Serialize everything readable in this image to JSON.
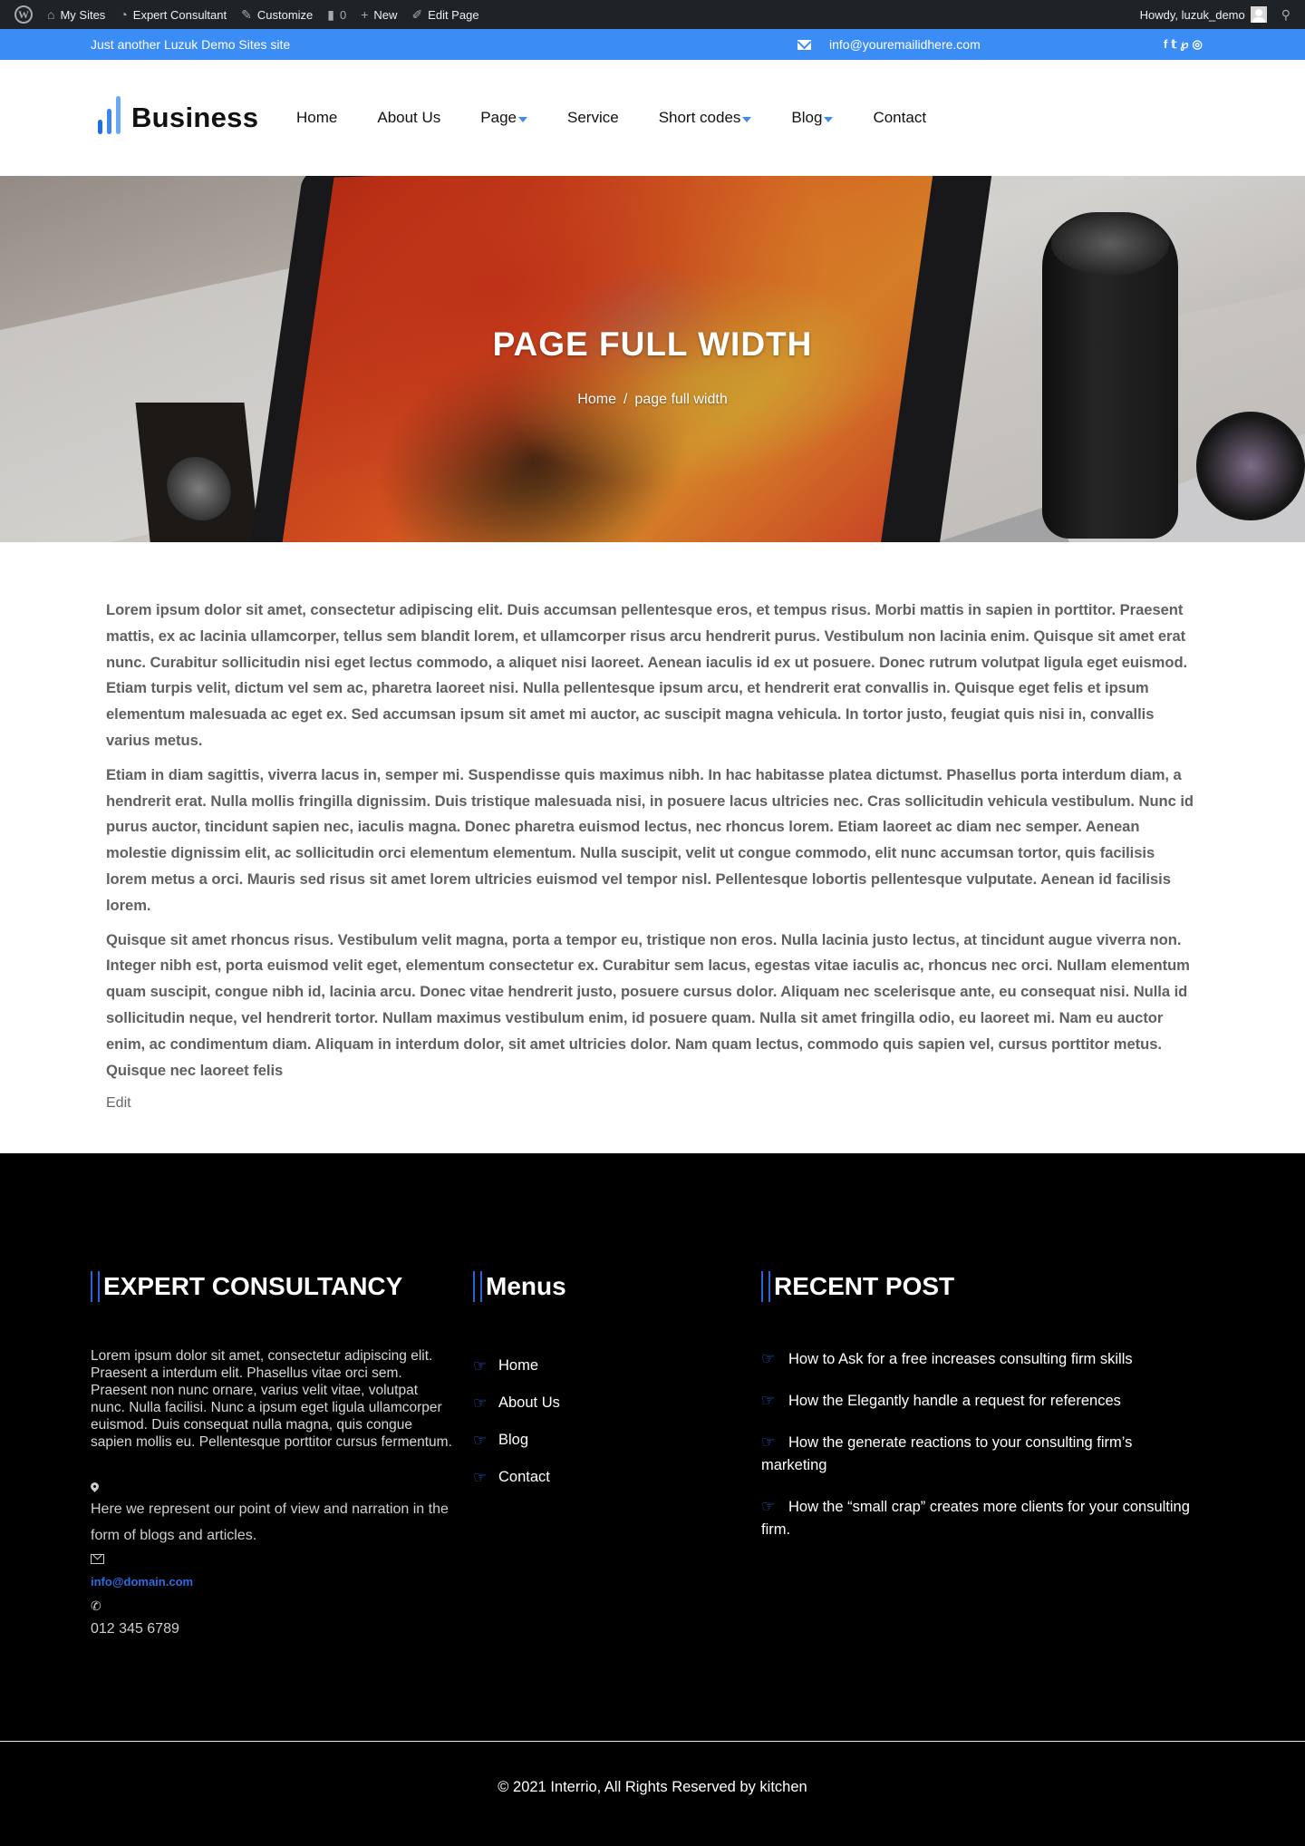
{
  "admin_bar": {
    "items": [
      {
        "label": "My Sites",
        "icon": "my-sites-icon"
      },
      {
        "label": "Expert Consultant",
        "icon": "dashboard-icon"
      },
      {
        "label": "Customize",
        "icon": "brush-icon"
      },
      {
        "label": "0",
        "icon": "comment-icon"
      },
      {
        "label": "New",
        "icon": "plus-icon"
      },
      {
        "label": "Edit Page",
        "icon": "pencil-icon"
      }
    ],
    "greeting": "Howdy, luzuk_demo"
  },
  "topbar": {
    "tagline": "Just another Luzuk Demo Sites site",
    "email": "info@youremailidhere.com",
    "social": [
      "f",
      "t",
      "p",
      "i"
    ]
  },
  "header": {
    "logo_text": "Business",
    "nav": [
      {
        "label": "Home",
        "has_dropdown": false
      },
      {
        "label": "About Us",
        "has_dropdown": false
      },
      {
        "label": "Page",
        "has_dropdown": true
      },
      {
        "label": "Service",
        "has_dropdown": false
      },
      {
        "label": "Short codes",
        "has_dropdown": true
      },
      {
        "label": "Blog",
        "has_dropdown": true
      },
      {
        "label": "Contact",
        "has_dropdown": false
      }
    ]
  },
  "hero": {
    "title": "PAGE FULL WIDTH",
    "breadcrumb": {
      "home": "Home",
      "separator": "/",
      "current": "page full width"
    }
  },
  "content": {
    "paragraphs": [
      "Lorem ipsum dolor sit amet, consectetur adipiscing elit. Duis accumsan pellentesque eros, et tempus risus. Morbi mattis in sapien in porttitor. Praesent mattis, ex ac lacinia ullamcorper, tellus sem blandit lorem, et ullamcorper risus arcu hendrerit purus. Vestibulum non lacinia enim. Quisque sit amet erat nunc. Curabitur sollicitudin nisi eget lectus commodo, a aliquet nisi laoreet. Aenean iaculis id ex ut posuere. Donec rutrum volutpat ligula eget euismod. Etiam turpis velit, dictum vel sem ac, pharetra laoreet nisi. Nulla pellentesque ipsum arcu, et hendrerit erat convallis in. Quisque eget felis et ipsum elementum malesuada ac eget ex. Sed accumsan ipsum sit amet mi auctor, ac suscipit magna vehicula. In tortor justo, feugiat quis nisi in, convallis varius metus.",
      "Etiam in diam sagittis, viverra lacus in, semper mi. Suspendisse quis maximus nibh. In hac habitasse platea dictumst. Phasellus porta interdum diam, a hendrerit erat. Nulla mollis fringilla dignissim. Duis tristique malesuada nisi, in posuere lacus ultricies nec. Cras sollicitudin vehicula vestibulum. Nunc id purus auctor, tincidunt sapien nec, iaculis magna. Donec pharetra euismod lectus, nec rhoncus lorem. Etiam laoreet ac diam nec semper. Aenean molestie dignissim elit, ac sollicitudin orci elementum elementum. Nulla suscipit, velit ut congue commodo, elit nunc accumsan tortor, quis facilisis lorem metus a orci. Mauris sed risus sit amet lorem ultricies euismod vel tempor nisl. Pellentesque lobortis pellentesque vulputate. Aenean id facilisis lorem.",
      "Quisque sit amet rhoncus risus. Vestibulum velit magna, porta a tempor eu, tristique non eros. Nulla lacinia justo lectus, at tincidunt augue viverra non. Integer nibh est, porta euismod velit eget, elementum consectetur ex. Curabitur sem lacus, egestas vitae iaculis ac, rhoncus nec orci. Nullam elementum quam suscipit, congue nibh id, lacinia arcu. Donec vitae hendrerit justo, posuere cursus dolor. Aliquam nec scelerisque ante, eu consequat nisi. Nulla id sollicitudin neque, vel hendrerit tortor. Nullam maximus vestibulum enim, id posuere quam. Nulla sit amet fringilla odio, eu laoreet mi. Nam eu auctor enim, ac condimentum diam. Aliquam in interdum dolor, sit amet ultricies dolor. Nam quam lectus, commodo quis sapien vel, cursus porttitor metus. Quisque nec laoreet felis"
    ],
    "edit_label": "Edit"
  },
  "footer": {
    "about": {
      "title": "EXPERT CONSULTANCY",
      "text": "Lorem ipsum dolor sit amet, consectetur adipiscing elit. Praesent a interdum elit. Phasellus vitae orci sem. Praesent non nunc ornare, varius velit vitae, volutpat nunc. Nulla facilisi. Nunc a ipsum eget ligula ullamcorper euismod. Duis consequat nulla magna, quis congue sapien mollis eu. Pellentesque porttitor cursus fermentum.",
      "address": "Here we represent our point of view and narration in the form of blogs and articles.",
      "email": "info@domain.com",
      "phone": "012 345 6789"
    },
    "menus": {
      "title": "Menus",
      "items": [
        "Home",
        "About Us",
        "Blog",
        "Contact"
      ]
    },
    "recent": {
      "title": "RECENT POST",
      "items": [
        "How to Ask for a free increases consulting firm skills",
        "How the Elegantly handle a request for references",
        "How the generate reactions to your consulting firm’s marketing",
        "How the “small crap” creates more clients for your consulting firm."
      ]
    },
    "copyright": "© 2021 Interrio, All Rights Reserved by kitchen"
  },
  "colors": {
    "accent": "#3c8cf6",
    "footer_accent": "#2c62d8",
    "admin_bar": "#1d2327",
    "footer_bg": "#000000"
  }
}
